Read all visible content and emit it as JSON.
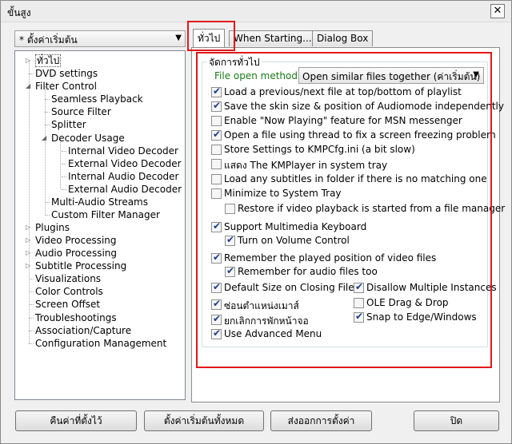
{
  "window": {
    "title": "ขั้นสูง",
    "close": "✕"
  },
  "profile_combo": {
    "value": "* ตั้งค่าเริ่มต้น"
  },
  "tree": {
    "items": [
      {
        "label": "ทั่วไป",
        "name": "tree-item-general"
      },
      {
        "label": "DVD settings",
        "name": "tree-item-dvd-settings"
      },
      {
        "label": "Filter Control",
        "name": "tree-item-filter-control"
      },
      {
        "label": "Seamless Playback",
        "name": "tree-item-seamless-playback"
      },
      {
        "label": "Source Filter",
        "name": "tree-item-source-filter"
      },
      {
        "label": "Splitter",
        "name": "tree-item-splitter"
      },
      {
        "label": "Decoder Usage",
        "name": "tree-item-decoder-usage"
      },
      {
        "label": "Internal Video Decoder",
        "name": "tree-item-internal-video-decoder"
      },
      {
        "label": "External Video Decoder",
        "name": "tree-item-external-video-decoder"
      },
      {
        "label": "Internal Audio Decoder",
        "name": "tree-item-internal-audio-decoder"
      },
      {
        "label": "External Audio Decoder",
        "name": "tree-item-external-audio-decoder"
      },
      {
        "label": "Multi-Audio Streams",
        "name": "tree-item-multi-audio-streams"
      },
      {
        "label": "Custom Filter Manager",
        "name": "tree-item-custom-filter-manager"
      },
      {
        "label": "Plugins",
        "name": "tree-item-plugins"
      },
      {
        "label": "Video Processing",
        "name": "tree-item-video-processing"
      },
      {
        "label": "Audio Processing",
        "name": "tree-item-audio-processing"
      },
      {
        "label": "Subtitle Processing",
        "name": "tree-item-subtitle-processing"
      },
      {
        "label": "Visualizations",
        "name": "tree-item-visualizations"
      },
      {
        "label": "Color Controls",
        "name": "tree-item-color-controls"
      },
      {
        "label": "Screen Offset",
        "name": "tree-item-screen-offset"
      },
      {
        "label": "Troubleshootings",
        "name": "tree-item-troubleshootings"
      },
      {
        "label": "Association/Capture",
        "name": "tree-item-association-capture"
      },
      {
        "label": "Configuration Management",
        "name": "tree-item-configuration-management"
      }
    ]
  },
  "tabs": [
    {
      "label": "ทั่วไป"
    },
    {
      "label": "When Starting..."
    },
    {
      "label": "Dialog Box"
    }
  ],
  "group": {
    "title": "จัดการทั่วไป",
    "file_open_method_label": "File open method:",
    "file_open_method_value": "Open similar files together (ค่าเริ่มต้น)"
  },
  "options": [
    {
      "label": "Load a previous/next file at top/bottom of playlist",
      "checked": true,
      "name": "load-prev-next-checkbox"
    },
    {
      "label": "Save the skin size & position of Audiomode independently",
      "checked": true,
      "name": "save-skin-size-checkbox"
    },
    {
      "label": "Enable \"Now Playing\" feature for MSN messenger",
      "checked": false,
      "name": "now-playing-msn-checkbox"
    },
    {
      "label": "Open a file using thread to fix a screen freezing problem",
      "checked": true,
      "name": "open-file-thread-checkbox"
    },
    {
      "label": "Store Settings to KMPCfg.ini (a bit slow)",
      "checked": false,
      "name": "store-settings-ini-checkbox"
    },
    {
      "label": "แสดง The KMPlayer in system tray",
      "checked": false,
      "name": "show-in-system-tray-checkbox"
    },
    {
      "label": "Load any subtitles in folder if there is no matching one",
      "checked": false,
      "name": "load-any-subtitles-checkbox"
    },
    {
      "label": "Minimize to System Tray",
      "checked": false,
      "name": "minimize-to-tray-checkbox"
    },
    {
      "label": "Restore if video playback is started from a file manager",
      "checked": false,
      "name": "restore-from-file-manager-checkbox"
    },
    {
      "label": "Support Multimedia Keyboard",
      "checked": true,
      "name": "multimedia-keyboard-checkbox"
    },
    {
      "label": "Turn on Volume Control",
      "checked": true,
      "name": "volume-control-checkbox"
    },
    {
      "label": "Remember the played position of video files",
      "checked": true,
      "name": "remember-video-position-checkbox"
    },
    {
      "label": "Remember for audio files too",
      "checked": true,
      "name": "remember-audio-position-checkbox"
    },
    {
      "label": "Default Size on Closing File",
      "checked": true,
      "name": "default-size-closing-checkbox"
    },
    {
      "label": "ซ่อนตำแหน่งเมาส์",
      "checked": true,
      "name": "hide-mouse-position-checkbox"
    },
    {
      "label": "ยกเลิกการพักหน้าจอ",
      "checked": true,
      "name": "disable-screensaver-checkbox"
    },
    {
      "label": "Use Advanced Menu",
      "checked": true,
      "name": "advanced-menu-checkbox"
    },
    {
      "label": "Disallow Multiple Instances",
      "checked": true,
      "name": "disallow-multiple-instances-checkbox"
    },
    {
      "label": "OLE Drag & Drop",
      "checked": false,
      "name": "ole-drag-drop-checkbox"
    },
    {
      "label": "Snap to Edge/Windows",
      "checked": true,
      "name": "snap-to-edge-checkbox"
    }
  ],
  "buttons": {
    "restore": "คืนค่าที่ตั้งไว้",
    "reset_all": "ตั้งค่าเริ่มต้นทั้งหมด",
    "export": "ส่งออกการตั้งค่า",
    "close": "ปิด"
  },
  "colors": {
    "highlight_box": "#e01818",
    "green_label": "#1a7a1a"
  }
}
